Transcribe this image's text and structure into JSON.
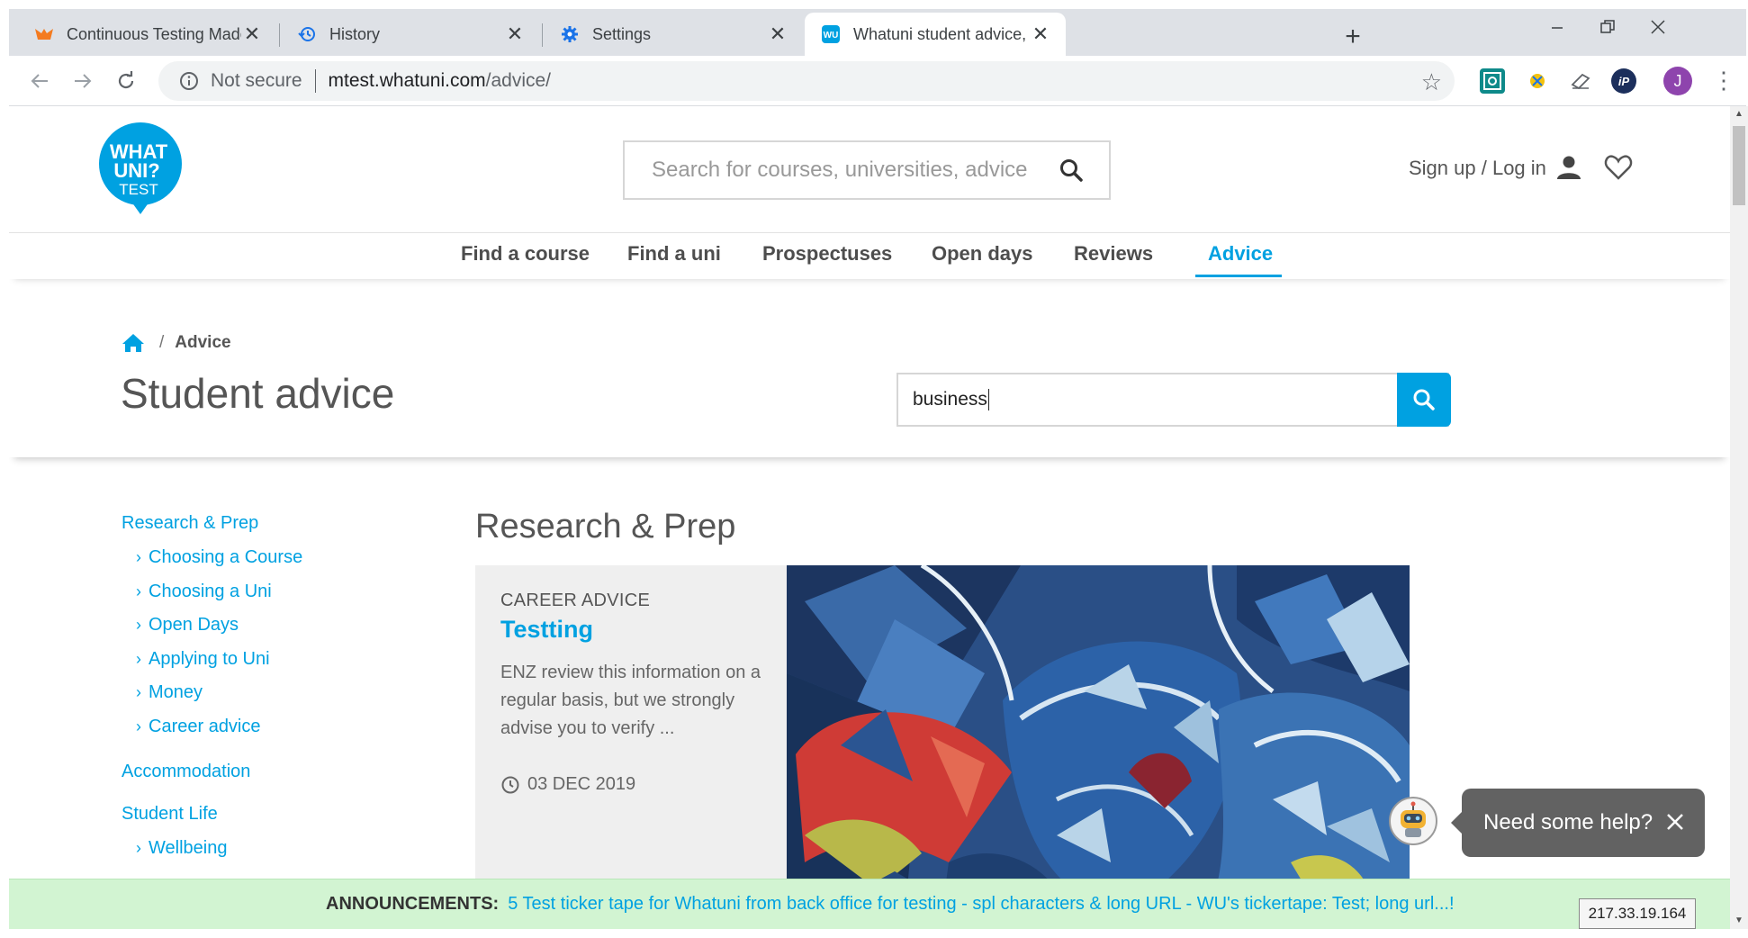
{
  "browser": {
    "tabs": [
      {
        "title": "Continuous Testing Made Easy | T",
        "active": false,
        "icon": "testing-app-icon"
      },
      {
        "title": "History",
        "active": false,
        "icon": "history-icon"
      },
      {
        "title": "Settings",
        "active": false,
        "icon": "gear-icon"
      },
      {
        "title": "Whatuni student advice, articles,",
        "active": true,
        "icon": "whatuni-favicon"
      }
    ],
    "close_glyph": "✕",
    "new_tab_glyph": "+",
    "omnibox": {
      "security_label": "Not secure",
      "url_host": "mtest.whatuni.com",
      "url_path": "/advice/"
    },
    "profile_initial": "J",
    "colors": {
      "tabstrip": "#dee1e6",
      "avatar": "#8e44ad"
    }
  },
  "site": {
    "logo": {
      "line1": "WHAT",
      "line2": "UNI?",
      "line3": "TEST"
    },
    "search_placeholder": "Search for courses, universities, advice",
    "signup_label": "Sign up / Log in",
    "nav": [
      {
        "label": "Find a course",
        "active": false
      },
      {
        "label": "Find a uni",
        "active": false
      },
      {
        "label": "Prospectuses",
        "active": false
      },
      {
        "label": "Open days",
        "active": false
      },
      {
        "label": "Reviews",
        "active": false
      },
      {
        "label": "Advice",
        "active": true
      }
    ],
    "accent_color": "#00a1e1"
  },
  "hero": {
    "breadcrumb_sep": "/",
    "breadcrumb_current": "Advice",
    "title": "Student advice",
    "search_value": "business"
  },
  "sidebar": {
    "sections": [
      {
        "label": "Research & Prep",
        "children": [
          "Choosing a Course",
          "Choosing a Uni",
          "Open Days",
          "Applying to Uni",
          "Money",
          "Career advice"
        ]
      },
      {
        "label": "Accommodation",
        "children": []
      },
      {
        "label": "Student Life",
        "children": [
          "Wellbeing"
        ]
      }
    ]
  },
  "content": {
    "section_title": "Research & Prep",
    "article": {
      "category": "CAREER ADVICE",
      "title": "Testting",
      "excerpt": "ENZ review this information on a regular basis, but we strongly advise you to verify ...",
      "date": "03 DEC 2019"
    }
  },
  "help_widget": {
    "label": "Need some help?"
  },
  "ticker": {
    "label": "ANNOUNCEMENTS:",
    "message": "5 Test ticker tape for Whatuni from back office for testing - spl characters & long URL - WU's tickertape: Test; long url...!",
    "background": "#d2f4d2"
  },
  "ip_address": "217.33.19.164"
}
